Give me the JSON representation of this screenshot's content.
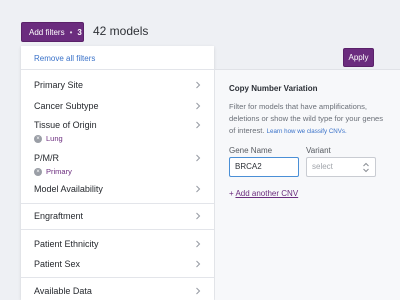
{
  "header": {
    "filters_button": {
      "label": "Add filters",
      "separator": "•",
      "count": "3"
    },
    "models_count": "42 models",
    "apply_label": "Apply"
  },
  "sidebar": {
    "remove_all": "Remove all filters",
    "items": [
      {
        "label": "Primary Site"
      },
      {
        "label": "Cancer Subtype"
      },
      {
        "label": "Tissue of Origin",
        "chip": "Lung"
      },
      {
        "label": "P/M/R",
        "chip": "Primary"
      },
      {
        "label": "Model Availability"
      },
      {
        "label": "Engraftment"
      },
      {
        "label": "Patient Ethnicity"
      },
      {
        "label": "Patient Sex"
      },
      {
        "label": "Available Data"
      }
    ]
  },
  "cnv_panel": {
    "title": "Copy Number Variation",
    "description": "Filter for models that have amplifications, deletions or show the wild type for your genes of interest.",
    "link_text": "Learn how we classify CNVs.",
    "gene_label": "Gene Name",
    "gene_value": "BRCA2",
    "variant_label": "Variant",
    "variant_placeholder": "select",
    "add_prefix": "+",
    "add_label": "Add another CNV"
  },
  "colors": {
    "accent": "#6b2c7e",
    "link": "#3a72c9",
    "background": "#eef0f4"
  },
  "icons": [
    "chevron-right-icon",
    "remove-chip-icon",
    "select-updown-icon"
  ]
}
